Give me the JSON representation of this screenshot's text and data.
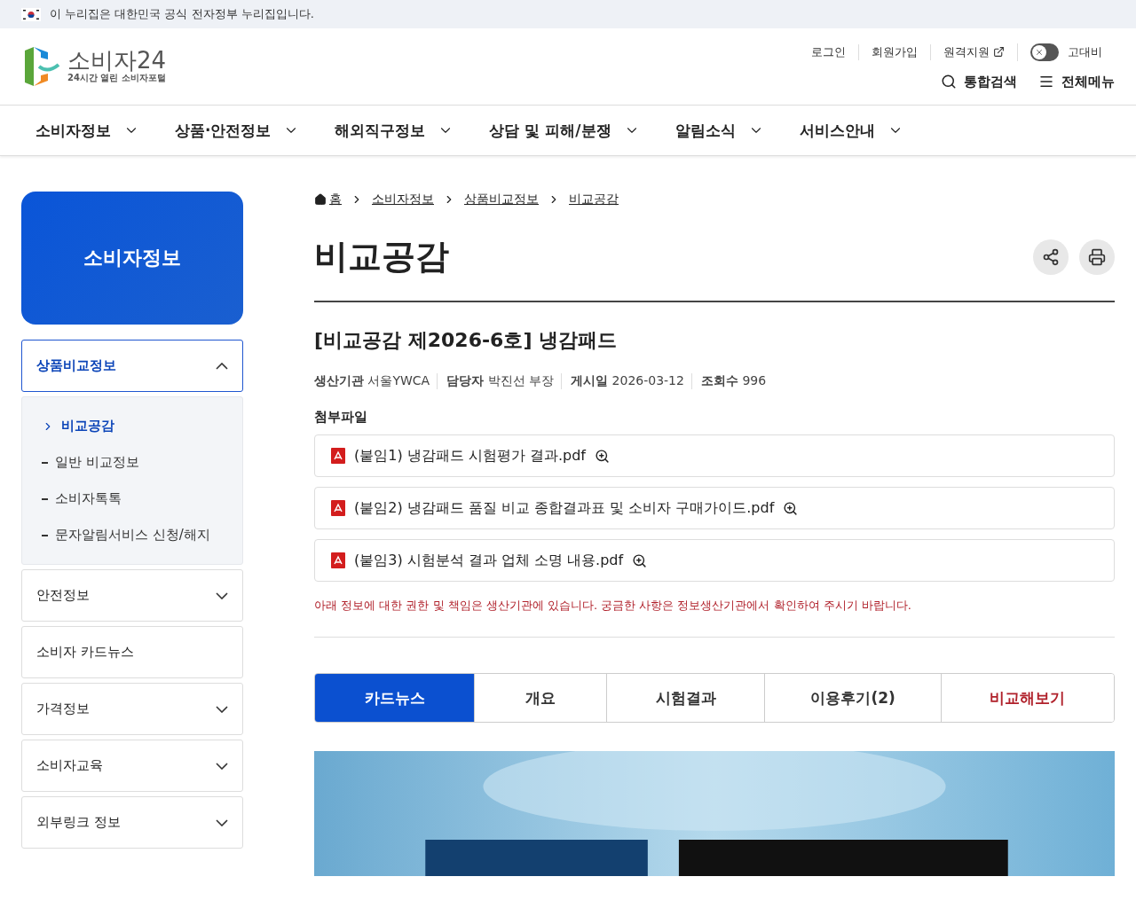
{
  "gov_banner": {
    "text": "이 누리집은 대한민국 공식 전자정부 누리집입니다."
  },
  "logo": {
    "name": "소비자24",
    "tagline": "24시간 열린 소비자포털"
  },
  "utility_links": [
    {
      "label": "로그인",
      "kind": "plain"
    },
    {
      "label": "회원가입",
      "kind": "plain"
    },
    {
      "label": "원격지원",
      "kind": "external"
    }
  ],
  "contrast_toggle": {
    "label": "고대비",
    "on": false
  },
  "header_actions": [
    {
      "label": "통합검색",
      "kind": "search"
    },
    {
      "label": "전체메뉴",
      "kind": "menu"
    }
  ],
  "main_nav": [
    "소비자정보",
    "상품·안전정보",
    "해외직구정보",
    "상담 및 피해/분쟁",
    "알림소식",
    "서비스안내"
  ],
  "sidebar": {
    "title": "소비자정보",
    "groups": [
      {
        "label": "상품비교정보",
        "expanded": true,
        "kind": "folder",
        "children": [
          {
            "label": "비교공감",
            "selected": true
          },
          {
            "label": "일반 비교정보",
            "selected": false
          },
          {
            "label": "소비자톡톡",
            "selected": false
          },
          {
            "label": "문자알림서비스 신청/해지",
            "selected": false
          }
        ]
      },
      {
        "label": "안전정보",
        "expanded": false,
        "kind": "folder"
      },
      {
        "label": "소비자 카드뉴스",
        "kind": "link"
      },
      {
        "label": "가격정보",
        "expanded": false,
        "kind": "folder"
      },
      {
        "label": "소비자교육",
        "expanded": false,
        "kind": "folder"
      },
      {
        "label": "외부링크 정보",
        "expanded": false,
        "kind": "folder"
      }
    ]
  },
  "breadcrumb": [
    "홈",
    "소비자정보",
    "상품비교정보",
    "비교공감"
  ],
  "page_title": "비교공감",
  "article": {
    "title": "[비교공감 제2026-6호] 냉감패드",
    "meta": [
      {
        "label": "생산기관",
        "value": "서울YWCA"
      },
      {
        "label": "담당자",
        "value": "박진선 부장"
      },
      {
        "label": "게시일",
        "value": "2026-03-12"
      },
      {
        "label": "조회수",
        "value": "996"
      }
    ],
    "attachments_label": "첨부파일",
    "attachments": [
      "(붙임1) 냉감패드 시험평가 결과.pdf",
      "(붙임2) 냉감패드 품질 비교 종합결과표 및 소비자 구매가이드.pdf",
      "(붙임3) 시험분석 결과 업체 소명 내용.pdf"
    ],
    "notice": "아래 정보에 대한 권한 및 책임은 생산기관에 있습니다. 궁금한 사항은 정보생산기관에서 확인하여 주시기 바랍니다."
  },
  "tabs": [
    {
      "label": "카드뉴스",
      "selected": true,
      "kind": "tab"
    },
    {
      "label": "개요",
      "selected": false,
      "kind": "tab"
    },
    {
      "label": "시험결과",
      "selected": false,
      "kind": "tab"
    },
    {
      "label": "이용후기(2)",
      "selected": false,
      "kind": "tab"
    },
    {
      "label": "비교해보기",
      "selected": false,
      "kind": "link"
    }
  ],
  "card_image": {
    "kind": "picture"
  }
}
